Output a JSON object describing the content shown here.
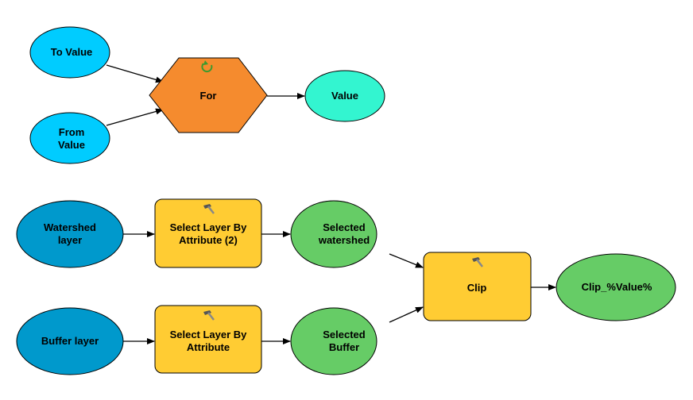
{
  "colors": {
    "input_variable": "#00CCFF",
    "iterator": "#F58B2E",
    "output_value": "#33F5D0",
    "data_layer": "#0099CC",
    "tool": "#FFCC33",
    "derived_data": "#66CC66"
  },
  "nodes": {
    "to_value": {
      "lines": [
        "To Value"
      ]
    },
    "from_value": {
      "lines": [
        "From",
        "Value"
      ]
    },
    "for": {
      "lines": [
        "For"
      ],
      "icon": "iterate-icon"
    },
    "value": {
      "lines": [
        "Value"
      ]
    },
    "watershed_layer": {
      "lines": [
        "Watershed",
        "layer"
      ]
    },
    "select_2": {
      "lines": [
        "Select Layer By",
        "Attribute (2)"
      ],
      "icon": "hammer-icon"
    },
    "selected_watershed": {
      "lines": [
        "Selected",
        "watershed"
      ]
    },
    "buffer_layer": {
      "lines": [
        "Buffer layer"
      ]
    },
    "select_1": {
      "lines": [
        "Select Layer By",
        "Attribute"
      ],
      "icon": "hammer-icon"
    },
    "selected_buffer": {
      "lines": [
        "Selected",
        "Buffer"
      ]
    },
    "clip": {
      "lines": [
        "Clip"
      ],
      "icon": "hammer-icon"
    },
    "clip_output": {
      "lines": [
        "Clip_%Value%"
      ]
    }
  },
  "edges": [
    [
      "to_value",
      "for"
    ],
    [
      "from_value",
      "for"
    ],
    [
      "for",
      "value"
    ],
    [
      "watershed_layer",
      "select_2"
    ],
    [
      "select_2",
      "selected_watershed"
    ],
    [
      "selected_watershed",
      "clip"
    ],
    [
      "buffer_layer",
      "select_1"
    ],
    [
      "select_1",
      "selected_buffer"
    ],
    [
      "selected_buffer",
      "clip"
    ],
    [
      "clip",
      "clip_output"
    ]
  ]
}
